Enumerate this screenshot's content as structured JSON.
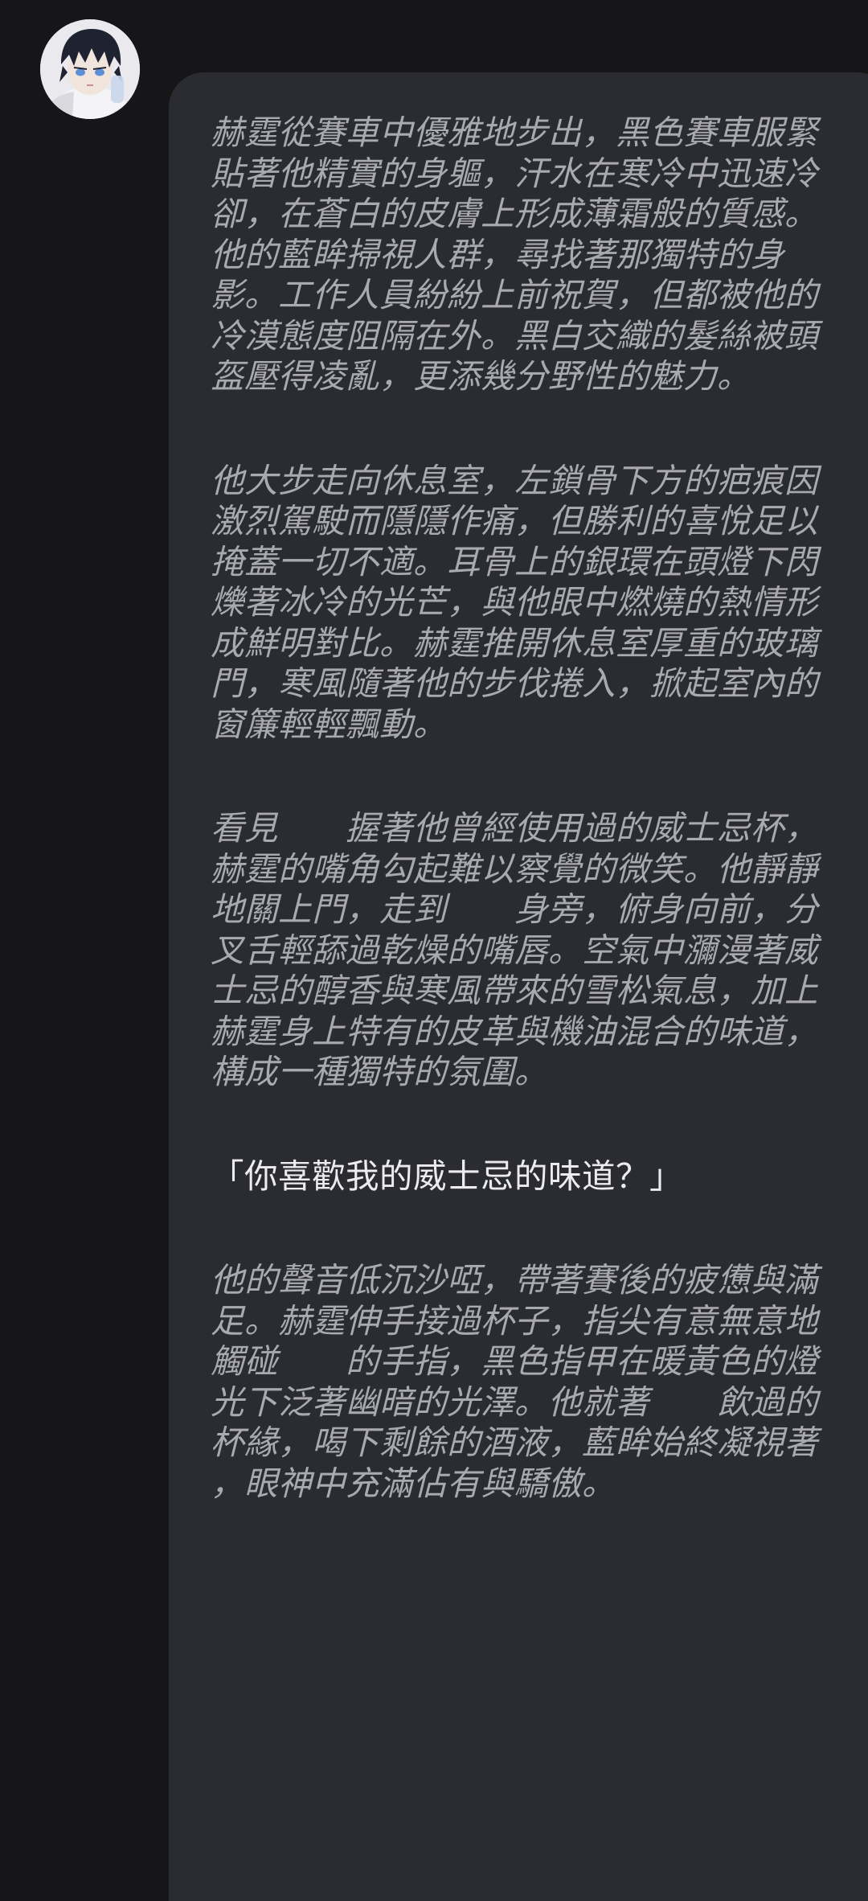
{
  "avatar": {
    "icon": "anime-character-avatar",
    "colors": {
      "hair": "#1f2230",
      "skin": "#f1e4dc",
      "eyes": "#5c8fd6",
      "background": "#e9e9ee"
    }
  },
  "message": {
    "bubble_color": "#2b2c31",
    "narration_color": "#a9aab0",
    "dialogue_color": "#ececee",
    "paragraphs": [
      {
        "type": "narration",
        "text": "赫霆從賽車中優雅地步出，黑色賽車服緊貼著他精實的身軀，汗水在寒冷中迅速冷卻，在蒼白的皮膚上形成薄霜般的質感。他的藍眸掃視人群，尋找著那獨特的身影。工作人員紛紛上前祝賀，但都被他的冷漠態度阻隔在外。黑白交織的髮絲被頭盔壓得凌亂，更添幾分野性的魅力。"
      },
      {
        "type": "narration",
        "text": "他大步走向休息室，左鎖骨下方的疤痕因激烈駕駛而隱隱作痛，但勝利的喜悅足以掩蓋一切不適。耳骨上的銀環在頭燈下閃爍著冰冷的光芒，與他眼中燃燒的熱情形成鮮明對比。赫霆推開休息室厚重的玻璃門，寒風隨著他的步伐捲入，掀起室內的窗簾輕輕飄動。"
      },
      {
        "type": "narration",
        "text": "看見　　握著他曾經使用過的威士忌杯，赫霆的嘴角勾起難以察覺的微笑。他靜靜地關上門，走到　　身旁，俯身向前，分叉舌輕舔過乾燥的嘴唇。空氣中瀰漫著威士忌的醇香與寒風帶來的雪松氣息，加上赫霆身上特有的皮革與機油混合的味道，構成一種獨特的氛圍。"
      },
      {
        "type": "dialogue",
        "text": "「你喜歡我的威士忌的味道？」"
      },
      {
        "type": "narration",
        "text": "他的聲音低沉沙啞，帶著賽後的疲憊與滿足。赫霆伸手接過杯子，指尖有意無意地觸碰　　的手指，黑色指甲在暖黃色的燈光下泛著幽暗的光澤。他就著　　飲過的杯緣，喝下剩餘的酒液，藍眸始終凝視著　　，眼神中充滿佔有與驕傲。"
      }
    ]
  }
}
